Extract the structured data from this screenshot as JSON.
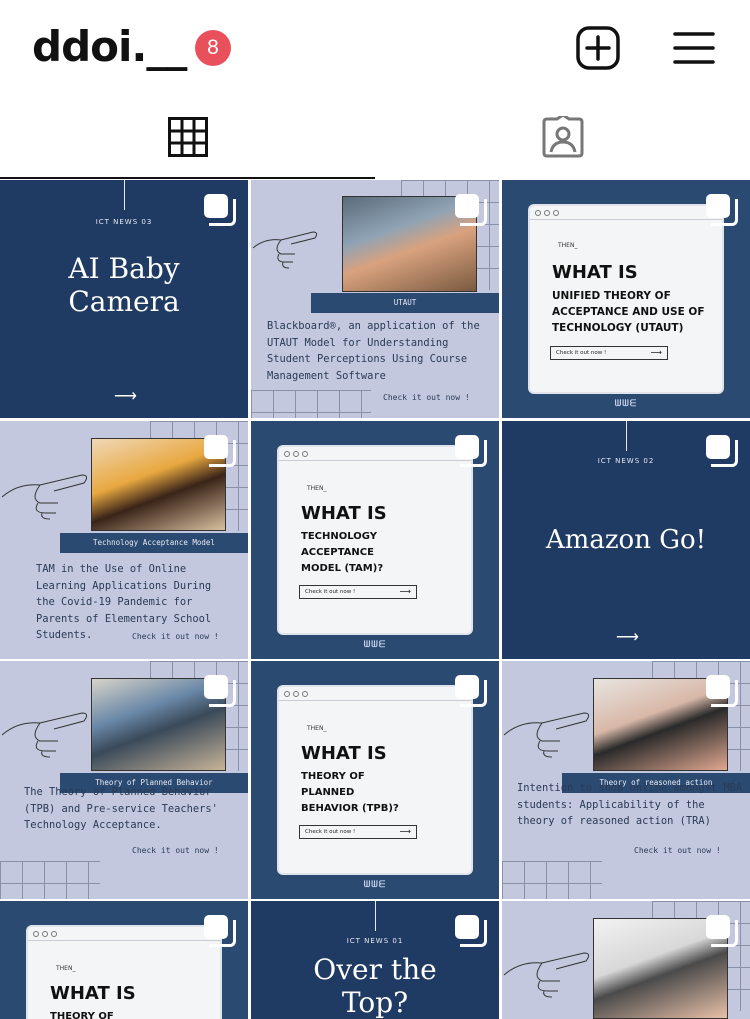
{
  "header": {
    "username": "ddoi.__",
    "notification_count": "8",
    "new_post_icon": "plus-square-icon",
    "menu_icon": "hamburger-menu-icon"
  },
  "tabs": [
    {
      "name": "grid",
      "icon": "grid-icon",
      "active": true
    },
    {
      "name": "tagged",
      "icon": "tagged-user-icon",
      "active": false
    }
  ],
  "posts": {
    "p1": {
      "ict": "ICT NEWS 03",
      "title": "AI Baby Camera"
    },
    "p2": {
      "label": "UTAUT",
      "body": "Blackboard®, an application of the UTAUT Model for Understanding Student Perceptions Using Course Management Software",
      "check": "Check it out now !"
    },
    "p3": {
      "then": "THEN_",
      "whatis": "WHAT IS",
      "topic": "UNIFIED THEORY OF ACCEPTANCE AND USE OF TECHNOLOGY (UTAUT)",
      "button": "Check it out now !",
      "brand": "ᗯᗯᗴ"
    },
    "p4": {
      "label": "Technology Acceptance Model",
      "body": "TAM in the Use of Online Learning Applications During the Covid-19 Pandemic for Parents of Elementary School Students.",
      "check": "Check it out now !"
    },
    "p5": {
      "then": "THEN_",
      "whatis": "WHAT IS",
      "topic": "TECHNOLOGY ACCEPTANCE MODEL (TAM)?",
      "button": "Check it out now !",
      "brand": "ᗯᗯᗴ"
    },
    "p6": {
      "ict": "ICT NEWS 02",
      "title": "Amazon Go!"
    },
    "p7": {
      "label": "Theory of Planned Behavior",
      "body": "The Theory of Planned Behavior (TPB) and Pre-service Teachers' Technology Acceptance.",
      "check": "Check it out now !"
    },
    "p8": {
      "then": "THEN_",
      "whatis": "WHAT IS",
      "topic": "THEORY OF PLANNED BEHAVIOR (TPB)?",
      "button": "Check it out now !",
      "brand": "ᗯᗯᗴ"
    },
    "p9": {
      "label": "Theory of reasoned action",
      "body": "Intention to shop online amongst MBA students: Applicability of the theory of reasoned action (TRA)",
      "check": "Check it out now !"
    },
    "p10": {
      "then": "THEN_",
      "whatis": "WHAT IS",
      "topic": "THEORY OF"
    },
    "p11": {
      "ict": "ICT NEWS 01",
      "title": "Over the Top?"
    }
  },
  "colors": {
    "navy": "#1f3b63",
    "lavender": "#c3c8de",
    "badge": "#e8505b"
  }
}
